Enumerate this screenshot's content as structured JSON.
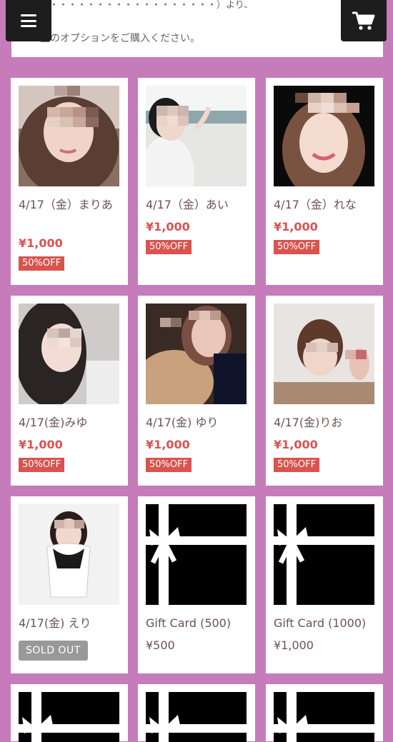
{
  "intro": {
    "line1": "ご・・・・・・・・・・・・・・・・・・）より、",
    "line2": "望のオプションをご購入ください。"
  },
  "header": {
    "menu_icon": "hamburger-menu-icon",
    "cart_icon": "shopping-cart-icon"
  },
  "products": [
    {
      "name": "4/17（金）まりあ",
      "price": "¥1,000",
      "badge": "50%OFF"
    },
    {
      "name": "4/17（金）あい",
      "price": "¥1,000",
      "badge": "50%OFF"
    },
    {
      "name": "4/17（金）れな",
      "price": "¥1,000",
      "badge": "50%OFF"
    },
    {
      "name": "4/17(金)みゆ",
      "price": "¥1,000",
      "badge": "50%OFF"
    },
    {
      "name": "4/17(金) ゆり",
      "price": "¥1,000",
      "badge": "50%OFF"
    },
    {
      "name": "4/17(金)りお",
      "price": "¥1,000",
      "badge": "50%OFF"
    },
    {
      "name": "4/17(金) えり",
      "status": "SOLD OUT"
    },
    {
      "name": "Gift Card (500)",
      "price": "¥500"
    },
    {
      "name": "Gift Card (1000)",
      "price": "¥1,000"
    }
  ],
  "colors": {
    "background": "#c67bbb",
    "price": "#d9534f",
    "badge": "#d9534f",
    "sold_out": "#999999",
    "header_button": "#1d1d1d"
  }
}
